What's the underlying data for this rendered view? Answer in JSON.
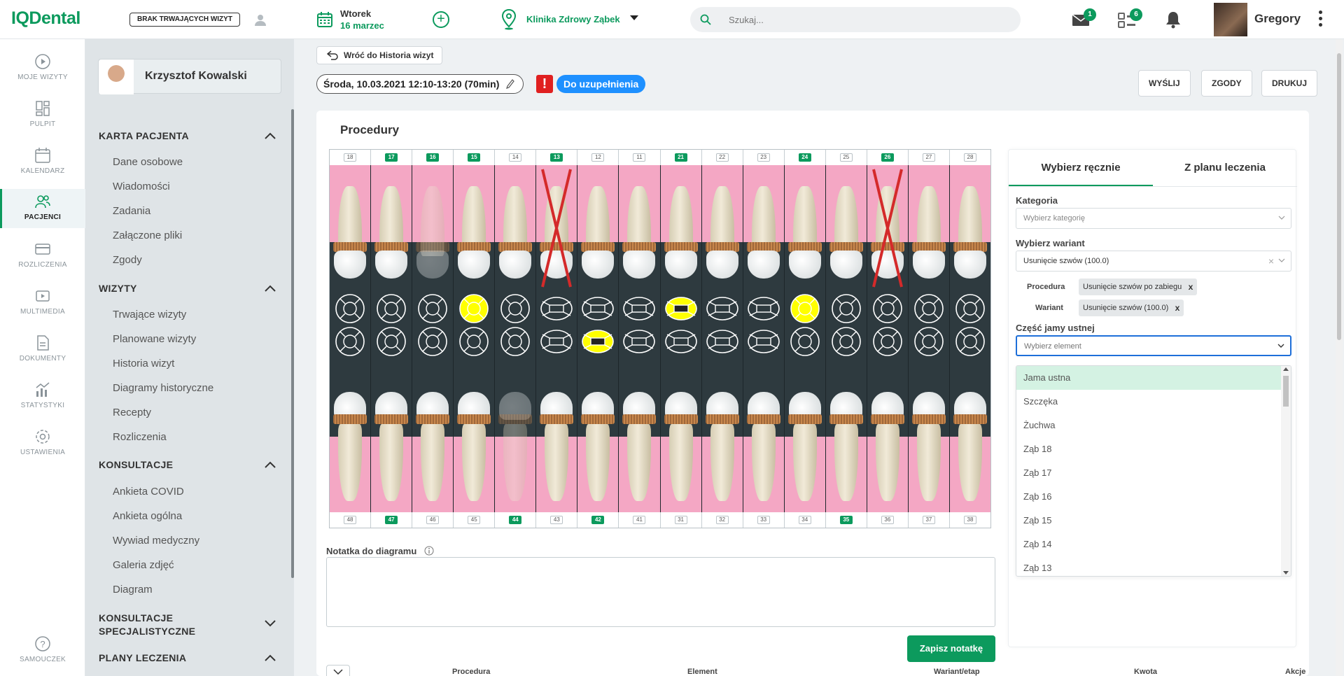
{
  "app": {
    "logo": "IQDental"
  },
  "header": {
    "visit_status": "BRAK TRWAJĄCYCH WIZYT",
    "day": "Wtorek",
    "date": "16 marzec",
    "clinic": "Klinika Zdrowy Ząbek",
    "search_placeholder": "Szukaj...",
    "messages_count": "1",
    "tasks_count": "6",
    "user_name": "Gregory"
  },
  "nav": {
    "items": [
      {
        "label": "MOJE WIZYTY",
        "icon": "play-circle-icon"
      },
      {
        "label": "PULPIT",
        "icon": "dashboard-icon"
      },
      {
        "label": "KALENDARZ",
        "icon": "calendar-icon"
      },
      {
        "label": "PACJENCI",
        "icon": "patients-icon"
      },
      {
        "label": "ROZLICZENIA",
        "icon": "card-icon"
      },
      {
        "label": "MULTIMEDIA",
        "icon": "media-icon"
      },
      {
        "label": "DOKUMENTY",
        "icon": "document-icon"
      },
      {
        "label": "STATYSTYKI",
        "icon": "stats-icon"
      },
      {
        "label": "USTAWIENIA",
        "icon": "settings-icon"
      }
    ],
    "help": "SAMOUCZEK",
    "active": "PACJENCI"
  },
  "patient": {
    "name": "Krzysztof Kowalski",
    "sections": [
      {
        "title": "KARTA PACJENTA",
        "items": [
          "Dane osobowe",
          "Wiadomości",
          "Zadania",
          "Załączone pliki",
          "Zgody"
        ]
      },
      {
        "title": "WIZYTY",
        "items": [
          "Trwające wizyty",
          "Planowane wizyty",
          "Historia wizyt",
          "Diagramy historyczne",
          "Recepty",
          "Rozliczenia"
        ]
      },
      {
        "title": "KONSULTACJE",
        "items": [
          "Ankieta COVID",
          "Ankieta ogólna",
          "Wywiad medyczny",
          "Galeria zdjęć",
          "Diagram"
        ]
      },
      {
        "title": "KONSULTACJE SPECJALISTYCZNE",
        "items": []
      },
      {
        "title": "PLANY LECZENIA",
        "items": []
      }
    ]
  },
  "visit": {
    "back_label": "Wróć do Historia wizyt",
    "date_label": "Środa, 10.03.2021 12:10-13:20 (70min)",
    "warning": "!",
    "status": "Do uzupełnienia",
    "actions": {
      "send": "WYŚLIJ",
      "consents": "ZGODY",
      "print": "DRUKUJ"
    }
  },
  "procedures": {
    "title": "Procedury",
    "upper_numbers": [
      "18",
      "17",
      "16",
      "15",
      "14",
      "13",
      "12",
      "11",
      "21",
      "22",
      "23",
      "24",
      "25",
      "26",
      "27",
      "28"
    ],
    "upper_highlighted": [
      "17",
      "16",
      "15",
      "13",
      "21",
      "24",
      "26"
    ],
    "lower_numbers": [
      "48",
      "47",
      "46",
      "45",
      "44",
      "43",
      "42",
      "41",
      "31",
      "32",
      "33",
      "34",
      "35",
      "36",
      "37",
      "38"
    ],
    "lower_highlighted": [
      "47",
      "44",
      "42",
      "35"
    ],
    "upper_extracted": [
      "13",
      "26"
    ],
    "upper_missing": [
      "16"
    ],
    "lower_missing": [
      "44"
    ],
    "upper_filled_surfaces": [
      "15",
      "21",
      "24"
    ],
    "lower_filled_surfaces": [
      "42"
    ]
  },
  "note": {
    "label": "Notatka do diagramu",
    "save_label": "Zapisz notatkę"
  },
  "table": {
    "headers": [
      "Procedura",
      "Element",
      "Wariant/etap",
      "Kwota",
      "Akcje"
    ]
  },
  "right_panel": {
    "tabs": [
      "Wybierz ręcznie",
      "Z planu leczenia"
    ],
    "active_tab": "Wybierz ręcznie",
    "category_label": "Kategoria",
    "category_placeholder": "Wybierz kategorię",
    "variant_label": "Wybierz wariant",
    "variant_value": "Usunięcie szwów (100.0)",
    "procedure_tag_label": "Procedura",
    "procedure_tag": "Usunięcie szwów po zabiegu",
    "variant_tag_label": "Wariant",
    "variant_tag": "Usunięcie szwów (100.0)",
    "mouth_label": "Część jamy ustnej",
    "mouth_placeholder": "Wybierz element",
    "options": [
      "Jama ustna",
      "Szczęka",
      "Żuchwa",
      "Ząb 18",
      "Ząb 17",
      "Ząb 16",
      "Ząb 15",
      "Ząb 14",
      "Ząb 13"
    ]
  },
  "colors": {
    "brand": "#0c9a5d",
    "status_blue": "#1e90ff",
    "warning_red": "#e02020",
    "gum_pink": "#f4a7c4",
    "chart_dark": "#2e3a3f",
    "filling_yellow": "#ffff00"
  }
}
